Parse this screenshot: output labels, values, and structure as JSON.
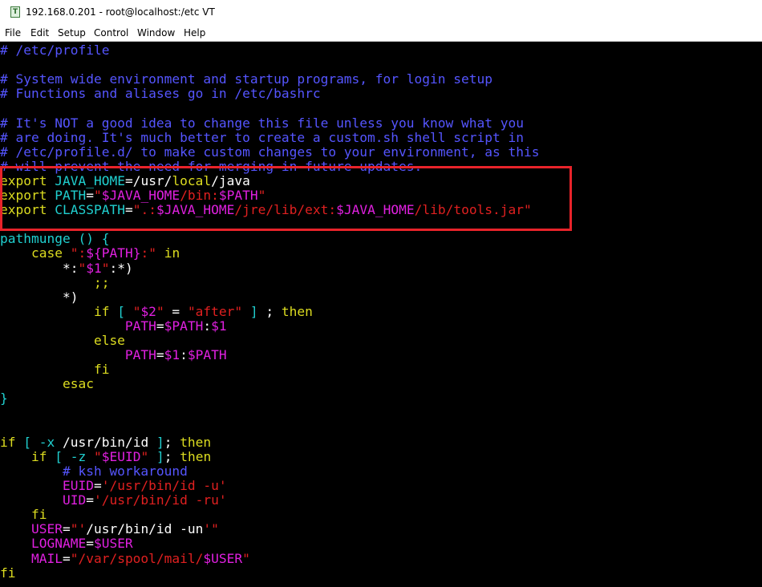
{
  "window": {
    "title": "192.168.0.201 - root@localhost:/etc VT",
    "icon": "terminal-icon"
  },
  "menu": [
    "File",
    "Edit",
    "Setup",
    "Control",
    "Window",
    "Help"
  ],
  "colors": {
    "comment": "#5555ff",
    "keyword": "#dcdc20",
    "identifier": "#20d0d0",
    "string": "#e02020",
    "variable": "#e020e0",
    "plain": "#ffffff",
    "highlight": "#e8232a"
  },
  "lines": [
    [
      {
        "t": "# /etc/profile",
        "c": "comment"
      }
    ],
    [],
    [
      {
        "t": "# System wide environment and startup programs, for login setup",
        "c": "comment"
      }
    ],
    [
      {
        "t": "# Functions and aliases go in /etc/bashrc",
        "c": "comment"
      }
    ],
    [],
    [
      {
        "t": "# It's NOT a good idea to change this file unless you know what you",
        "c": "comment"
      }
    ],
    [
      {
        "t": "# are doing. It's much better to create a custom.sh shell script in",
        "c": "comment"
      }
    ],
    [
      {
        "t": "# /etc/profile.d/ to make custom changes to your environment, as this",
        "c": "comment"
      }
    ],
    [
      {
        "t": "# will prevent the need for merging in future updates.",
        "c": "comment"
      }
    ],
    [
      {
        "t": "export ",
        "c": "keyword"
      },
      {
        "t": "JAVA_HOME",
        "c": "identifier"
      },
      {
        "t": "=/usr/",
        "c": "plain"
      },
      {
        "t": "local",
        "c": "keyword"
      },
      {
        "t": "/java",
        "c": "plain"
      }
    ],
    [
      {
        "t": "export ",
        "c": "keyword"
      },
      {
        "t": "PATH",
        "c": "identifier"
      },
      {
        "t": "=",
        "c": "plain"
      },
      {
        "t": "\"",
        "c": "string"
      },
      {
        "t": "$JAVA_HOME",
        "c": "variable"
      },
      {
        "t": "/bin:",
        "c": "string"
      },
      {
        "t": "$PATH",
        "c": "variable"
      },
      {
        "t": "\"",
        "c": "string"
      }
    ],
    [
      {
        "t": "export ",
        "c": "keyword"
      },
      {
        "t": "CLASSPATH",
        "c": "identifier"
      },
      {
        "t": "=",
        "c": "plain"
      },
      {
        "t": "\".:",
        "c": "string"
      },
      {
        "t": "$JAVA_HOME",
        "c": "variable"
      },
      {
        "t": "/jre/lib/ext:",
        "c": "string"
      },
      {
        "t": "$JAVA_HOME",
        "c": "variable"
      },
      {
        "t": "/lib/tools.jar\"",
        "c": "string"
      }
    ],
    [],
    [
      {
        "t": "pathmunge () {",
        "c": "identifier"
      }
    ],
    [
      {
        "t": "    case ",
        "c": "keyword"
      },
      {
        "t": "\":",
        "c": "string"
      },
      {
        "t": "${PATH}",
        "c": "variable"
      },
      {
        "t": ":\"",
        "c": "string"
      },
      {
        "t": " in",
        "c": "keyword"
      }
    ],
    [
      {
        "t": "        *:",
        "c": "plain"
      },
      {
        "t": "\"",
        "c": "string"
      },
      {
        "t": "$1",
        "c": "variable"
      },
      {
        "t": "\"",
        "c": "string"
      },
      {
        "t": ":*)",
        "c": "plain"
      }
    ],
    [
      {
        "t": "            ;;",
        "c": "keyword"
      }
    ],
    [
      {
        "t": "        *)",
        "c": "plain"
      }
    ],
    [
      {
        "t": "            if ",
        "c": "keyword"
      },
      {
        "t": "[ ",
        "c": "identifier"
      },
      {
        "t": "\"",
        "c": "string"
      },
      {
        "t": "$2",
        "c": "variable"
      },
      {
        "t": "\"",
        "c": "string"
      },
      {
        "t": " = ",
        "c": "plain"
      },
      {
        "t": "\"after\"",
        "c": "string"
      },
      {
        "t": " ] ",
        "c": "identifier"
      },
      {
        "t": "; ",
        "c": "plain"
      },
      {
        "t": "then",
        "c": "keyword"
      }
    ],
    [
      {
        "t": "                PATH",
        "c": "variable"
      },
      {
        "t": "=",
        "c": "plain"
      },
      {
        "t": "$PATH",
        "c": "variable"
      },
      {
        "t": ":",
        "c": "plain"
      },
      {
        "t": "$1",
        "c": "variable"
      }
    ],
    [
      {
        "t": "            else",
        "c": "keyword"
      }
    ],
    [
      {
        "t": "                PATH",
        "c": "variable"
      },
      {
        "t": "=",
        "c": "plain"
      },
      {
        "t": "$1",
        "c": "variable"
      },
      {
        "t": ":",
        "c": "plain"
      },
      {
        "t": "$PATH",
        "c": "variable"
      }
    ],
    [
      {
        "t": "            fi",
        "c": "keyword"
      }
    ],
    [
      {
        "t": "        esac",
        "c": "keyword"
      }
    ],
    [
      {
        "t": "}",
        "c": "identifier"
      }
    ],
    [],
    [],
    [
      {
        "t": "if ",
        "c": "keyword"
      },
      {
        "t": "[ -x ",
        "c": "identifier"
      },
      {
        "t": "/usr/bin/id ",
        "c": "plain"
      },
      {
        "t": "]",
        "c": "identifier"
      },
      {
        "t": "; ",
        "c": "plain"
      },
      {
        "t": "then",
        "c": "keyword"
      }
    ],
    [
      {
        "t": "    if ",
        "c": "keyword"
      },
      {
        "t": "[ -z ",
        "c": "identifier"
      },
      {
        "t": "\"",
        "c": "string"
      },
      {
        "t": "$EUID",
        "c": "variable"
      },
      {
        "t": "\"",
        "c": "string"
      },
      {
        "t": " ]",
        "c": "identifier"
      },
      {
        "t": "; ",
        "c": "plain"
      },
      {
        "t": "then",
        "c": "keyword"
      }
    ],
    [
      {
        "t": "        # ksh workaround",
        "c": "comment"
      }
    ],
    [
      {
        "t": "        EUID",
        "c": "variable"
      },
      {
        "t": "=",
        "c": "plain"
      },
      {
        "t": "'/usr/bin/id -u'",
        "c": "string"
      }
    ],
    [
      {
        "t": "        UID",
        "c": "variable"
      },
      {
        "t": "=",
        "c": "plain"
      },
      {
        "t": "'/usr/bin/id -ru'",
        "c": "string"
      }
    ],
    [
      {
        "t": "    fi",
        "c": "keyword"
      }
    ],
    [
      {
        "t": "    USER",
        "c": "variable"
      },
      {
        "t": "=",
        "c": "plain"
      },
      {
        "t": "\"'",
        "c": "string"
      },
      {
        "t": "/usr/bin/id -un",
        "c": "plain"
      },
      {
        "t": "'\"",
        "c": "string"
      }
    ],
    [
      {
        "t": "    LOGNAME",
        "c": "variable"
      },
      {
        "t": "=",
        "c": "plain"
      },
      {
        "t": "$USER",
        "c": "variable"
      }
    ],
    [
      {
        "t": "    MAIL",
        "c": "variable"
      },
      {
        "t": "=",
        "c": "plain"
      },
      {
        "t": "\"/var/spool/mail/",
        "c": "string"
      },
      {
        "t": "$USER",
        "c": "variable"
      },
      {
        "t": "\"",
        "c": "string"
      }
    ],
    [
      {
        "t": "fi",
        "c": "keyword"
      }
    ]
  ]
}
